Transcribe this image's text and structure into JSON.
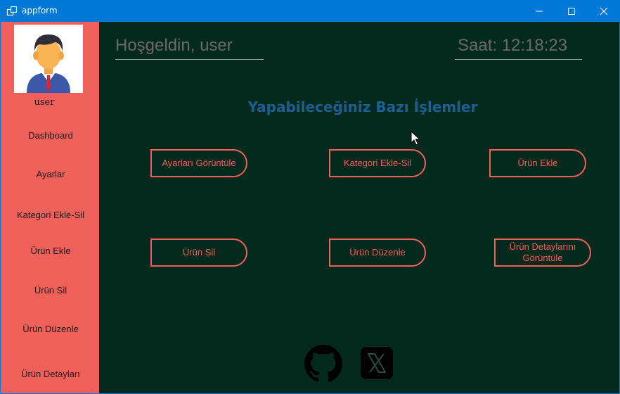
{
  "window": {
    "title": "appform"
  },
  "sidebar": {
    "username": "user",
    "items": [
      {
        "label": "Dashboard"
      },
      {
        "label": "Ayarlar"
      },
      {
        "label": "Kategori Ekle-Sil"
      },
      {
        "label": "Ürün Ekle"
      },
      {
        "label": "Ürün Sil"
      },
      {
        "label": "Ürün Düzenle"
      },
      {
        "label": "Ürün Detayları"
      }
    ]
  },
  "header": {
    "welcome": "Hoşgeldin, user",
    "clock": "Saat: 12:18:23"
  },
  "main": {
    "heading": "Yapabileceğiniz Bazı İşlemler",
    "actions": [
      {
        "label": "Ayarları Görüntüle"
      },
      {
        "label": "Kategori Ekle-Sil"
      },
      {
        "label": "Ürün Ekle"
      },
      {
        "label": "Ürün Sil"
      },
      {
        "label": "Ürün Düzenle"
      },
      {
        "label": "Ürün Detaylarını Görüntüle"
      }
    ]
  },
  "social": [
    {
      "icon": "github-icon"
    },
    {
      "icon": "x-icon"
    }
  ],
  "colors": {
    "titlebar": "#0078d7",
    "sidebar": "#f0605a",
    "main_bg": "#04291d",
    "accent": "#f0605a",
    "heading": "#1e5f91"
  }
}
